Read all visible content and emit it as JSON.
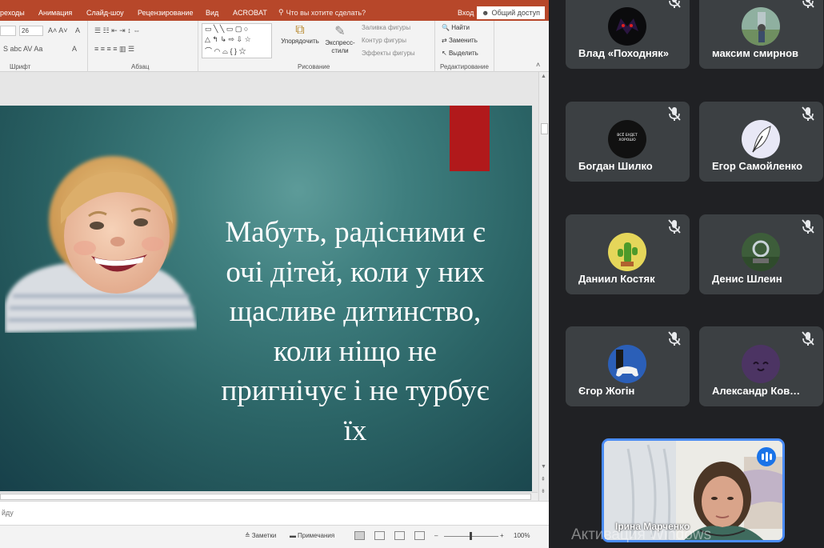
{
  "menu": {
    "items": [
      "реходы",
      "Анимация",
      "Слайд-шоу",
      "Рецензирование",
      "Вид",
      "ACROBAT"
    ],
    "tellme": "Что вы хотите сделать?",
    "signin": "Вход",
    "share": "Общий доступ"
  },
  "ribbon": {
    "font_size": "26",
    "group_font": "Шрифт",
    "group_paragraph": "Абзац",
    "group_drawing": "Рисование",
    "group_editing": "Редактирование",
    "arrange": "Упорядочить",
    "express_styles": "Экспресс-стили",
    "shape_fill": "Заливка фигуры",
    "shape_outline": "Контур фигуры",
    "shape_effects": "Эффекты фигуры",
    "find": "Найти",
    "replace": "Заменить",
    "select": "Выделить"
  },
  "slide": {
    "text": "Мабуть, радісними є очі дітей, коли у них щасливе дитинство, коли ніщо не пригнічує і не турбує їх",
    "accent": "#b1191b"
  },
  "notes": {
    "placeholder": "йду"
  },
  "status": {
    "notes": "Заметки",
    "comments": "Примечания",
    "zoom": "100%"
  },
  "participants": [
    {
      "name": "Влад «Походняк»",
      "avatar": "dark-logo",
      "muted": true
    },
    {
      "name": "максим смирнов",
      "avatar": "photo-outdoor",
      "muted": true
    },
    {
      "name": "Богдан Шилко",
      "avatar": "black-text-logo",
      "avatar_text": "ВСЁ БУДЕТ ХОРОШО",
      "muted": true
    },
    {
      "name": "Егор Самойленко",
      "avatar": "quill-pen",
      "muted": true
    },
    {
      "name": "Даниил Костяк",
      "avatar": "cactus-cartoon",
      "muted": true
    },
    {
      "name": "Денис Шлеин",
      "avatar": "photo-landscape",
      "muted": true
    },
    {
      "name": "Єгор Жогін",
      "avatar": "game-controller",
      "muted": true
    },
    {
      "name": "Александр Ков…",
      "avatar": "purple-smiley",
      "muted": true
    }
  ],
  "self_view": {
    "name": "Ірина Марченко",
    "speaking": true
  },
  "watermark": "Активация Windows"
}
